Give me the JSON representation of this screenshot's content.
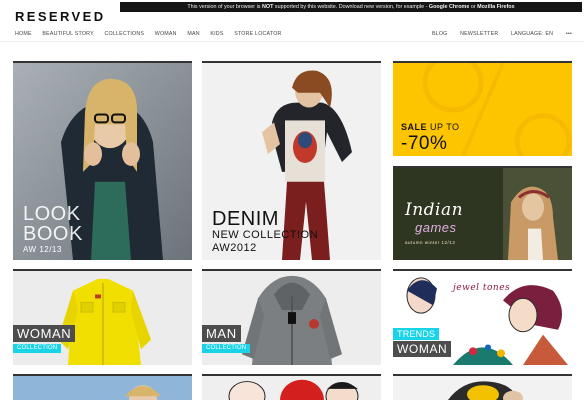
{
  "notice": {
    "prefix": "This version of your browser is",
    "not": "NOT",
    "middle": "supported by this website. Download new version, for example -",
    "chrome": "Google Chrome",
    "or": "or",
    "firefox": "Mozilla Firefox"
  },
  "brand": {
    "logo": "RESERVED"
  },
  "nav": {
    "left": [
      "HOME",
      "BEAUTIFUL STORY",
      "COLLECTIONS",
      "WOMAN",
      "MAN",
      "KIDS",
      "STORE LOCATOR"
    ],
    "right": [
      "BLOG",
      "NEWSLETTER",
      "LANGUAGE: EN",
      "•••"
    ]
  },
  "tiles": {
    "lookbook": {
      "line1": "LOOK",
      "line2": "BOOK",
      "season": "AW 12/13"
    },
    "denim": {
      "title": "DENIM",
      "subtitle": "NEW COLLECTION",
      "season": "AW2012"
    },
    "sale": {
      "label": "SALE",
      "upto": "UP TO",
      "percent": "-70%"
    },
    "indian": {
      "word1": "Indian",
      "word2": "games",
      "caption": "autumn winter 12/13"
    },
    "woman": {
      "label": "WOMAN",
      "sub": "COLLECTION"
    },
    "man": {
      "label": "MAN",
      "sub": "COLLECTION"
    },
    "trends": {
      "top": "TRENDS",
      "label": "WOMAN",
      "art": "jewel tones"
    }
  },
  "colors": {
    "sale_yellow": "#fdc500",
    "cyan": "#19d3e6",
    "label_gray": "#4d4d4d"
  }
}
